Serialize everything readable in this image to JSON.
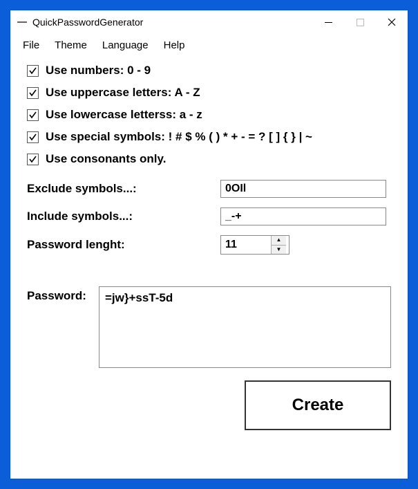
{
  "window": {
    "title": "QuickPasswordGenerator"
  },
  "menu": {
    "file": "File",
    "theme": "Theme",
    "language": "Language",
    "help": "Help"
  },
  "options": {
    "numbers": "Use numbers: 0 - 9",
    "uppercase": "Use uppercase letters: A - Z",
    "lowercase": "Use lowercase letterss: a - z",
    "special": "Use special symbols: ! # $ % ( ) * + - = ? [ ] { } | ~",
    "consonants": "Use consonants only."
  },
  "fields": {
    "exclude_label": "Exclude symbols...:",
    "exclude_value": "0OIl",
    "include_label": "Include symbols...:",
    "include_value": "_-+",
    "length_label": "Password lenght:",
    "length_value": "11"
  },
  "output": {
    "label": "Password:",
    "value": "=jw}+ssT-5d"
  },
  "buttons": {
    "create": "Create"
  }
}
